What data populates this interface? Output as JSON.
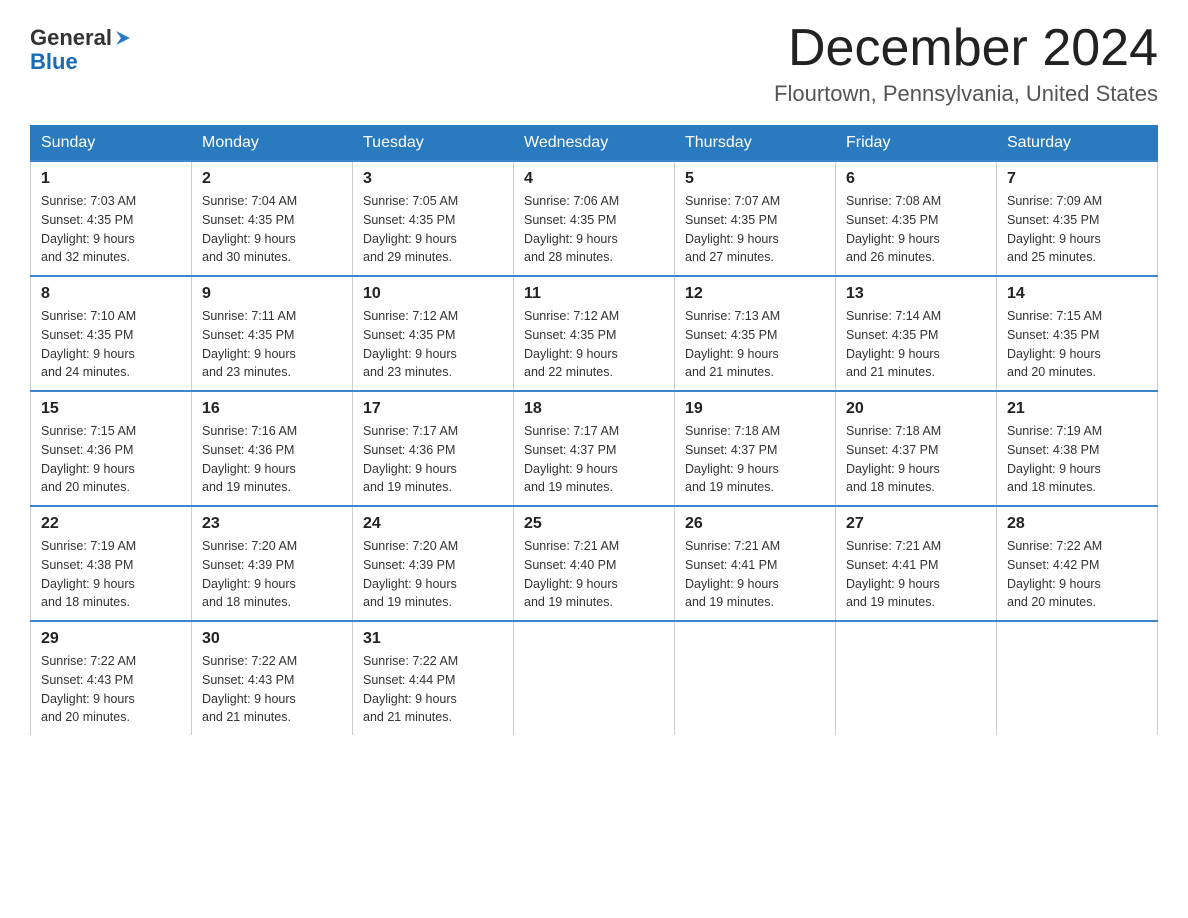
{
  "logo": {
    "general_text": "General",
    "blue_text": "Blue"
  },
  "title": {
    "month_year": "December 2024",
    "location": "Flourtown, Pennsylvania, United States"
  },
  "weekdays": [
    "Sunday",
    "Monday",
    "Tuesday",
    "Wednesday",
    "Thursday",
    "Friday",
    "Saturday"
  ],
  "weeks": [
    [
      {
        "day": "1",
        "sunrise": "7:03 AM",
        "sunset": "4:35 PM",
        "daylight": "9 hours and 32 minutes."
      },
      {
        "day": "2",
        "sunrise": "7:04 AM",
        "sunset": "4:35 PM",
        "daylight": "9 hours and 30 minutes."
      },
      {
        "day": "3",
        "sunrise": "7:05 AM",
        "sunset": "4:35 PM",
        "daylight": "9 hours and 29 minutes."
      },
      {
        "day": "4",
        "sunrise": "7:06 AM",
        "sunset": "4:35 PM",
        "daylight": "9 hours and 28 minutes."
      },
      {
        "day": "5",
        "sunrise": "7:07 AM",
        "sunset": "4:35 PM",
        "daylight": "9 hours and 27 minutes."
      },
      {
        "day": "6",
        "sunrise": "7:08 AM",
        "sunset": "4:35 PM",
        "daylight": "9 hours and 26 minutes."
      },
      {
        "day": "7",
        "sunrise": "7:09 AM",
        "sunset": "4:35 PM",
        "daylight": "9 hours and 25 minutes."
      }
    ],
    [
      {
        "day": "8",
        "sunrise": "7:10 AM",
        "sunset": "4:35 PM",
        "daylight": "9 hours and 24 minutes."
      },
      {
        "day": "9",
        "sunrise": "7:11 AM",
        "sunset": "4:35 PM",
        "daylight": "9 hours and 23 minutes."
      },
      {
        "day": "10",
        "sunrise": "7:12 AM",
        "sunset": "4:35 PM",
        "daylight": "9 hours and 23 minutes."
      },
      {
        "day": "11",
        "sunrise": "7:12 AM",
        "sunset": "4:35 PM",
        "daylight": "9 hours and 22 minutes."
      },
      {
        "day": "12",
        "sunrise": "7:13 AM",
        "sunset": "4:35 PM",
        "daylight": "9 hours and 21 minutes."
      },
      {
        "day": "13",
        "sunrise": "7:14 AM",
        "sunset": "4:35 PM",
        "daylight": "9 hours and 21 minutes."
      },
      {
        "day": "14",
        "sunrise": "7:15 AM",
        "sunset": "4:35 PM",
        "daylight": "9 hours and 20 minutes."
      }
    ],
    [
      {
        "day": "15",
        "sunrise": "7:15 AM",
        "sunset": "4:36 PM",
        "daylight": "9 hours and 20 minutes."
      },
      {
        "day": "16",
        "sunrise": "7:16 AM",
        "sunset": "4:36 PM",
        "daylight": "9 hours and 19 minutes."
      },
      {
        "day": "17",
        "sunrise": "7:17 AM",
        "sunset": "4:36 PM",
        "daylight": "9 hours and 19 minutes."
      },
      {
        "day": "18",
        "sunrise": "7:17 AM",
        "sunset": "4:37 PM",
        "daylight": "9 hours and 19 minutes."
      },
      {
        "day": "19",
        "sunrise": "7:18 AM",
        "sunset": "4:37 PM",
        "daylight": "9 hours and 19 minutes."
      },
      {
        "day": "20",
        "sunrise": "7:18 AM",
        "sunset": "4:37 PM",
        "daylight": "9 hours and 18 minutes."
      },
      {
        "day": "21",
        "sunrise": "7:19 AM",
        "sunset": "4:38 PM",
        "daylight": "9 hours and 18 minutes."
      }
    ],
    [
      {
        "day": "22",
        "sunrise": "7:19 AM",
        "sunset": "4:38 PM",
        "daylight": "9 hours and 18 minutes."
      },
      {
        "day": "23",
        "sunrise": "7:20 AM",
        "sunset": "4:39 PM",
        "daylight": "9 hours and 18 minutes."
      },
      {
        "day": "24",
        "sunrise": "7:20 AM",
        "sunset": "4:39 PM",
        "daylight": "9 hours and 19 minutes."
      },
      {
        "day": "25",
        "sunrise": "7:21 AM",
        "sunset": "4:40 PM",
        "daylight": "9 hours and 19 minutes."
      },
      {
        "day": "26",
        "sunrise": "7:21 AM",
        "sunset": "4:41 PM",
        "daylight": "9 hours and 19 minutes."
      },
      {
        "day": "27",
        "sunrise": "7:21 AM",
        "sunset": "4:41 PM",
        "daylight": "9 hours and 19 minutes."
      },
      {
        "day": "28",
        "sunrise": "7:22 AM",
        "sunset": "4:42 PM",
        "daylight": "9 hours and 20 minutes."
      }
    ],
    [
      {
        "day": "29",
        "sunrise": "7:22 AM",
        "sunset": "4:43 PM",
        "daylight": "9 hours and 20 minutes."
      },
      {
        "day": "30",
        "sunrise": "7:22 AM",
        "sunset": "4:43 PM",
        "daylight": "9 hours and 21 minutes."
      },
      {
        "day": "31",
        "sunrise": "7:22 AM",
        "sunset": "4:44 PM",
        "daylight": "9 hours and 21 minutes."
      },
      null,
      null,
      null,
      null
    ]
  ],
  "labels": {
    "sunrise": "Sunrise: ",
    "sunset": "Sunset: ",
    "daylight": "Daylight: "
  }
}
